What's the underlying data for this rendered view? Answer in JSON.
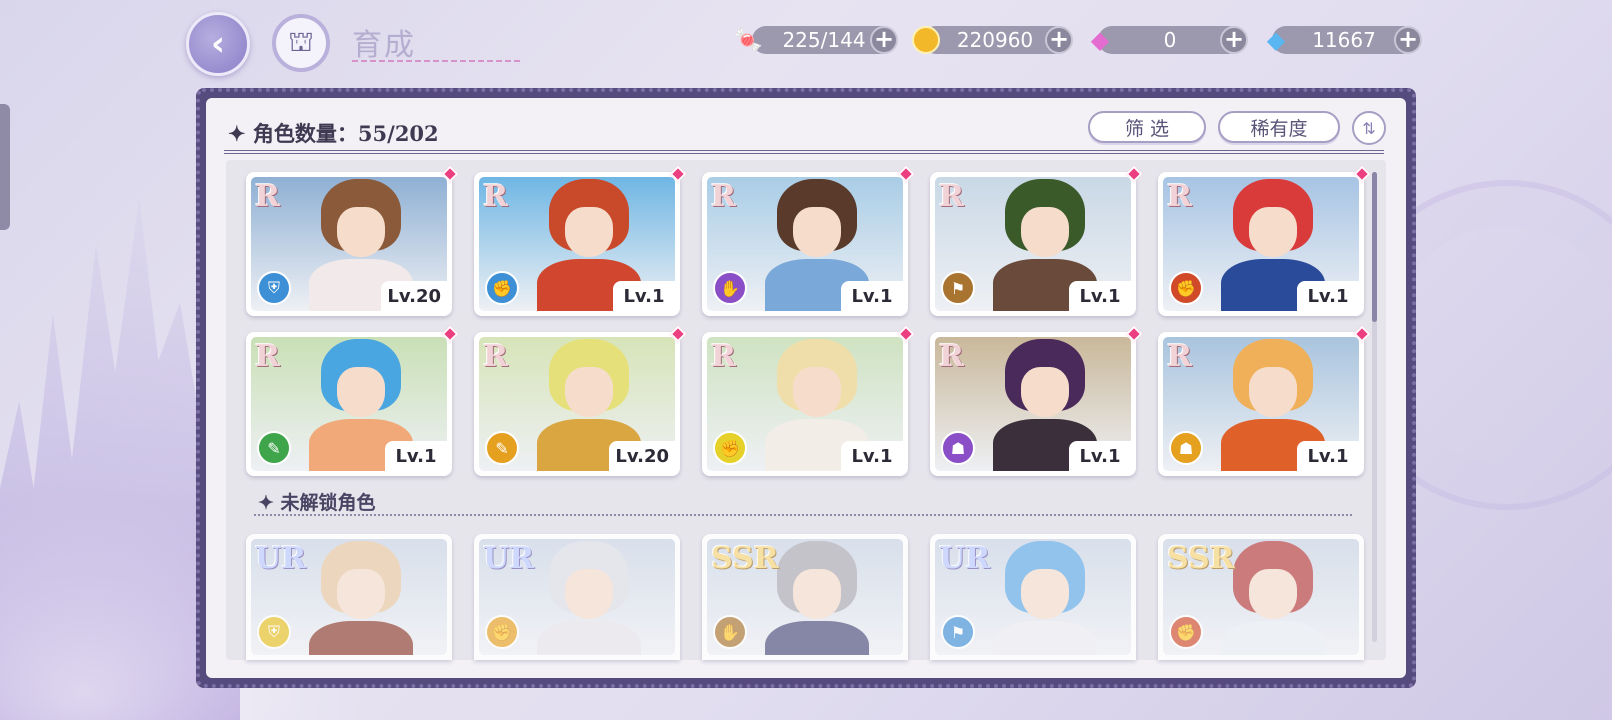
{
  "header": {
    "page_title": "育成",
    "back_icon": "back-arrow-icon",
    "home_icon": "castle-home-icon"
  },
  "resources": [
    {
      "name": "stamina",
      "icon": "candy-icon",
      "value": "225/144"
    },
    {
      "name": "coins",
      "icon": "gold-coin-icon",
      "value": "220960"
    },
    {
      "name": "paid-gems",
      "icon": "pink-diamond-icon",
      "value": "0"
    },
    {
      "name": "free-gems",
      "icon": "blue-diamond-icon",
      "value": "11667"
    }
  ],
  "panel": {
    "count_label": "角色数量：55/202",
    "filter_label": "筛 选",
    "rarity_label": "稀有度",
    "locked_section_label": "未解锁角色"
  },
  "owned_characters": [
    {
      "rank": "R",
      "level": "Lv.20",
      "type_color": "#3d8fd6",
      "hair": "#8a5a3a",
      "outfit": "#f1e9ea",
      "sky": "#8fb0d4"
    },
    {
      "rank": "R",
      "level": "Lv.1",
      "type_color": "#3d8fd6",
      "hair": "#c84a2a",
      "outfit": "#d0462e",
      "sky": "#6fb6e4"
    },
    {
      "rank": "R",
      "level": "Lv.1",
      "type_color": "#8a4fc6",
      "hair": "#5a3a2a",
      "outfit": "#7aa8d8",
      "sky": "#a9cde6"
    },
    {
      "rank": "R",
      "level": "Lv.1",
      "type_color": "#a8742f",
      "hair": "#3b5a2a",
      "outfit": "#6a4a3a",
      "sky": "#c9d8e6"
    },
    {
      "rank": "R",
      "level": "Lv.1",
      "type_color": "#d04a2a",
      "hair": "#d93a3a",
      "outfit": "#2a4a9a",
      "sky": "#a6c4e4"
    },
    {
      "rank": "R",
      "level": "Lv.1",
      "type_color": "#3fa54a",
      "hair": "#4aa6e0",
      "outfit": "#f1a97a",
      "sky": "#c9e0b6"
    },
    {
      "rank": "R",
      "level": "Lv.20",
      "type_color": "#e6a020",
      "hair": "#e6e07a",
      "outfit": "#d9a642",
      "sky": "#d7e4b8"
    },
    {
      "rank": "R",
      "level": "Lv.1",
      "type_color": "#e6d02a",
      "hair": "#f0deaa",
      "outfit": "#f2ede6",
      "sky": "#cfe3c2"
    },
    {
      "rank": "R",
      "level": "Lv.1",
      "type_color": "#8a4fc6",
      "hair": "#4a2a5a",
      "outfit": "#3a2f3a",
      "sky": "#c9b89a"
    },
    {
      "rank": "R",
      "level": "Lv.1",
      "type_color": "#e6a020",
      "hair": "#f0b05a",
      "outfit": "#e0602a",
      "sky": "#a9c4de"
    }
  ],
  "locked_characters": [
    {
      "rank": "UR",
      "type_color": "#e6c020",
      "hair": "#e6c7a0",
      "outfit": "#8a3a2a",
      "sky": "#c8d3e4"
    },
    {
      "rank": "UR",
      "type_color": "#e6a020",
      "hair": "#dcdce6",
      "outfit": "#e6e2ea",
      "sky": "#c8d3e4"
    },
    {
      "rank": "SSR",
      "type_color": "#a8742f",
      "hair": "#a8a8b0",
      "outfit": "#4a4a7a",
      "sky": "#c8d3e4"
    },
    {
      "rank": "UR",
      "type_color": "#3d8fd6",
      "hair": "#5aa8e6",
      "outfit": "#eeeef2",
      "sky": "#c8d3e4"
    },
    {
      "rank": "SSR",
      "type_color": "#d04a2a",
      "hair": "#b43a3a",
      "outfit": "#e8eef4",
      "sky": "#c8d3e4"
    }
  ]
}
